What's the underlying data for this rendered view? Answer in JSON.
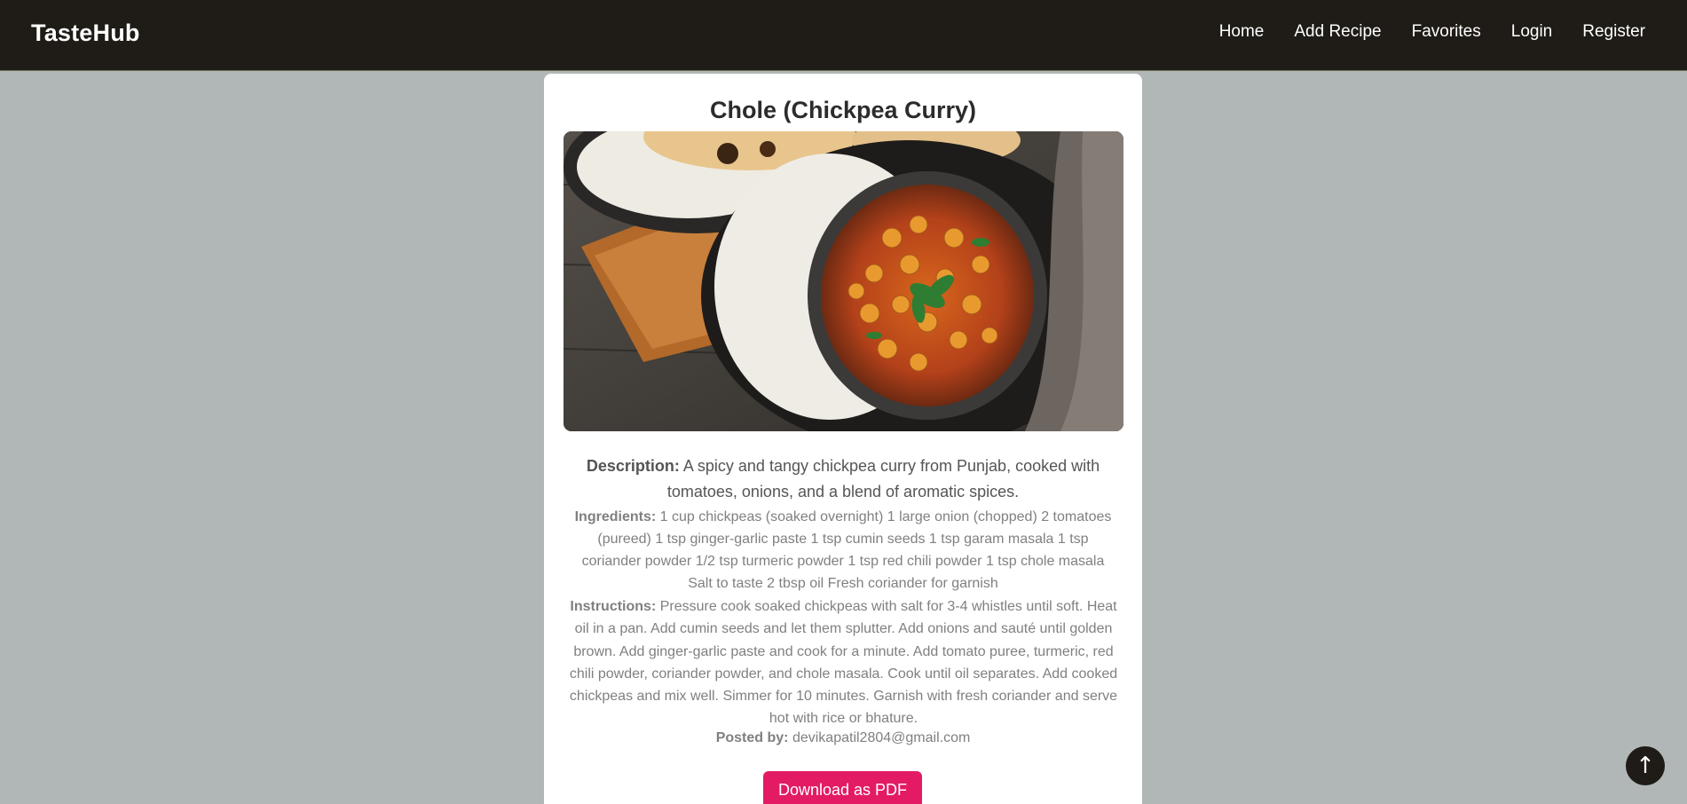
{
  "navbar": {
    "brand": "TasteHub",
    "links": [
      "Home",
      "Add Recipe",
      "Favorites",
      "Login",
      "Register"
    ]
  },
  "recipe": {
    "title": "Chole (Chickpea Curry)",
    "image_icon": "recipe-photo",
    "description_label": "Description:",
    "description": " A spicy and tangy chickpea curry from Punjab, cooked with tomatoes, onions, and a blend of aromatic spices.",
    "ingredients_label": "Ingredients:",
    "ingredients": " 1 cup chickpeas (soaked overnight) 1 large onion (chopped) 2 tomatoes (pureed) 1 tsp ginger-garlic paste 1 tsp cumin seeds 1 tsp garam masala 1 tsp coriander powder 1/2 tsp turmeric powder 1 tsp red chili powder 1 tsp chole masala Salt to taste 2 tbsp oil Fresh coriander for garnish",
    "instructions_label": "Instructions:",
    "instructions": " Pressure cook soaked chickpeas with salt for 3-4 whistles until soft. Heat oil in a pan. Add cumin seeds and let them splutter. Add onions and sauté until golden brown. Add ginger-garlic paste and cook for a minute. Add tomato puree, turmeric, red chili powder, coriander powder, and chole masala. Cook until oil separates. Add cooked chickpeas and mix well. Simmer for 10 minutes. Garnish with fresh coriander and serve hot with rice or bhature.",
    "posted_label": "Posted by:",
    "posted_by": " devikapatil2804@gmail.com",
    "download_label": "Download as PDF"
  },
  "scroll_top": {
    "icon": "arrow-up-icon",
    "glyph": "↑"
  },
  "colors": {
    "page_bg": "#b1b7b6",
    "navbar_bg": "#1f1b16",
    "accent": "#e31b64"
  }
}
